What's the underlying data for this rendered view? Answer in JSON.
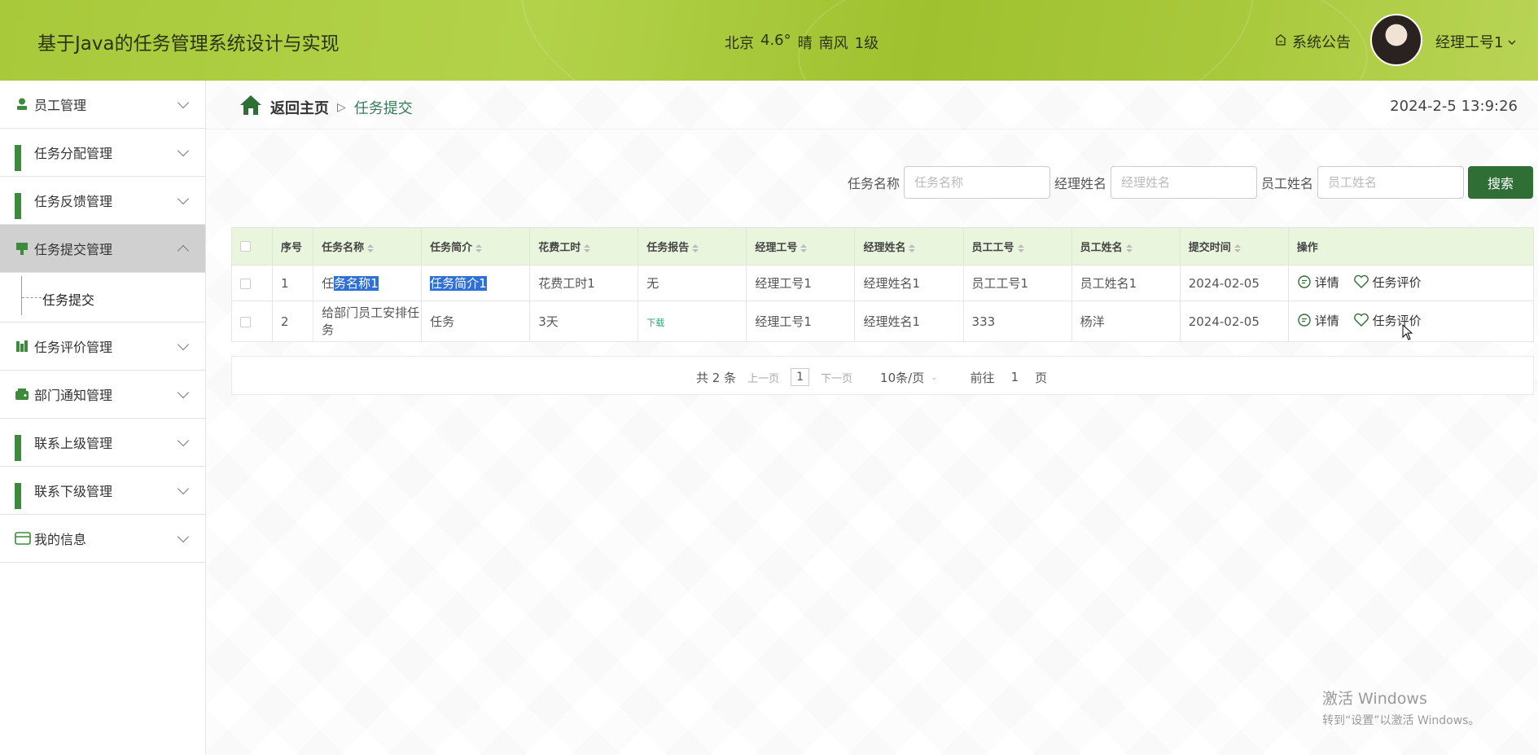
{
  "header": {
    "title": "基于Java的任务管理系统设计与实现",
    "weather": {
      "city": "北京",
      "temp": "4.6°",
      "condition": "晴",
      "wind": "南风",
      "level": "1级"
    },
    "announcement": "系统公告",
    "user": "经理工号1"
  },
  "sidebar": {
    "items": [
      {
        "label": "员工管理",
        "icon": "user-icon"
      },
      {
        "label": "任务分配管理",
        "icon": "grid-icon"
      },
      {
        "label": "任务反馈管理",
        "icon": "grid-icon"
      },
      {
        "label": "任务提交管理",
        "icon": "upload-icon",
        "active": true
      },
      {
        "label": "任务评价管理",
        "icon": "chart-icon"
      },
      {
        "label": "部门通知管理",
        "icon": "wallet-icon"
      },
      {
        "label": "联系上级管理",
        "icon": "grid-icon"
      },
      {
        "label": "联系下级管理",
        "icon": "grid-icon"
      },
      {
        "label": "我的信息",
        "icon": "card-icon"
      }
    ],
    "submenu": {
      "label": "任务提交"
    }
  },
  "breadcrumb": {
    "home": "返回主页",
    "separator": "▷",
    "current": "任务提交"
  },
  "clock": "2024-2-5 13:9:26",
  "search": {
    "fields": [
      {
        "label": "任务名称",
        "placeholder": "任务名称"
      },
      {
        "label": "经理姓名",
        "placeholder": "经理姓名"
      },
      {
        "label": "员工姓名",
        "placeholder": "员工姓名"
      }
    ],
    "button": "搜索"
  },
  "table": {
    "headers": [
      "序号",
      "任务名称",
      "任务简介",
      "花费工时",
      "任务报告",
      "经理工号",
      "经理姓名",
      "员工工号",
      "员工姓名",
      "提交时间",
      "操作"
    ],
    "rows": [
      {
        "no": "1",
        "name_a": "任",
        "name_b": "务名称1",
        "intro": "任务简介1",
        "hours": "花费工时1",
        "report": "无",
        "mgr_no": "经理工号1",
        "mgr_name": "经理姓名1",
        "emp_no": "员工工号1",
        "emp_name": "员工姓名1",
        "time": "2024-02-05"
      },
      {
        "no": "2",
        "name": "给部门员工安排任务",
        "intro": "任务",
        "hours": "3天",
        "report": "下载",
        "mgr_no": "经理工号1",
        "mgr_name": "经理姓名1",
        "emp_no": "333",
        "emp_name": "杨洋",
        "time": "2024-02-05"
      }
    ],
    "actions": {
      "detail": "详情",
      "evaluate": "任务评价"
    }
  },
  "pager": {
    "total": "共 2 条",
    "prev": "上一页",
    "page": "1",
    "next": "下一页",
    "size": "10条/页",
    "goto": "前往",
    "goto_page": "1",
    "page_unit": "页"
  },
  "watermark": {
    "line1": "激活 Windows",
    "line2": "转到“设置”以激活 Windows。"
  },
  "colors": {
    "header": "#a8c93a",
    "accent": "#2f6e35",
    "table_head": "#e9f6dd",
    "selection": "#2f6fd6"
  }
}
